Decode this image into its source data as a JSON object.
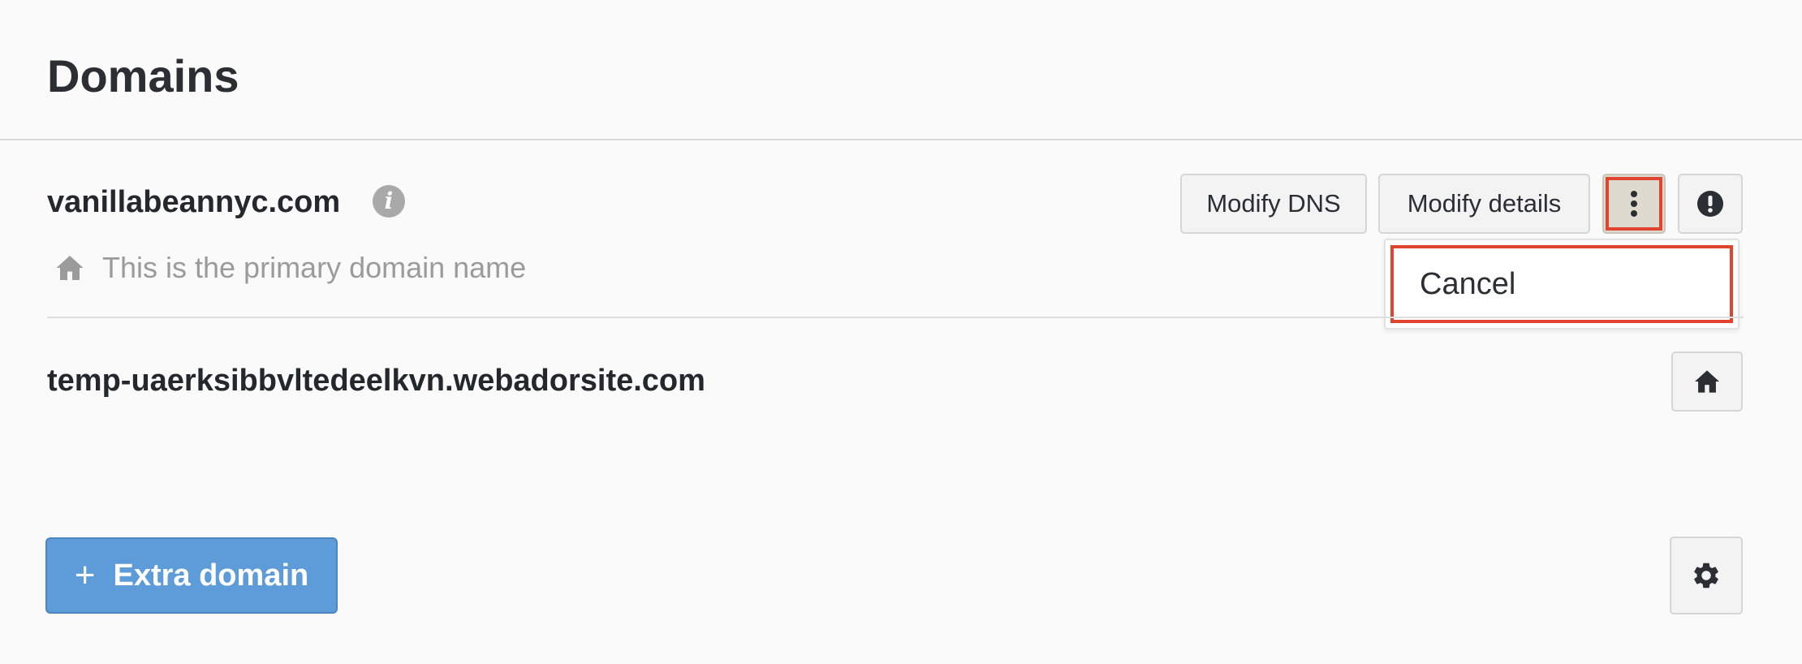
{
  "page": {
    "title": "Domains"
  },
  "domains": [
    {
      "name": "vanillabeannyc.com",
      "is_primary": true,
      "primary_note": "This is the primary domain name",
      "actions": {
        "modify_dns_label": "Modify DNS",
        "modify_details_label": "Modify details"
      }
    },
    {
      "name": "temp-uaerksibbvltedeelkvn.webadorsite.com",
      "is_primary": false
    }
  ],
  "more_menu": {
    "open": true,
    "items": [
      {
        "label": "Cancel"
      }
    ]
  },
  "footer": {
    "extra_domain_plus": "+",
    "extra_domain_label": "Extra domain"
  },
  "icons": {
    "info": "info-icon",
    "primary_note": "home-icon",
    "more": "more-vertical-icon",
    "warning": "alert-circle-icon",
    "set_primary": "home-icon",
    "settings": "gear-icon"
  },
  "colors": {
    "accent": "#5d9cd8",
    "highlight": "#e0442e",
    "muted_text": "#9b9b9b"
  }
}
